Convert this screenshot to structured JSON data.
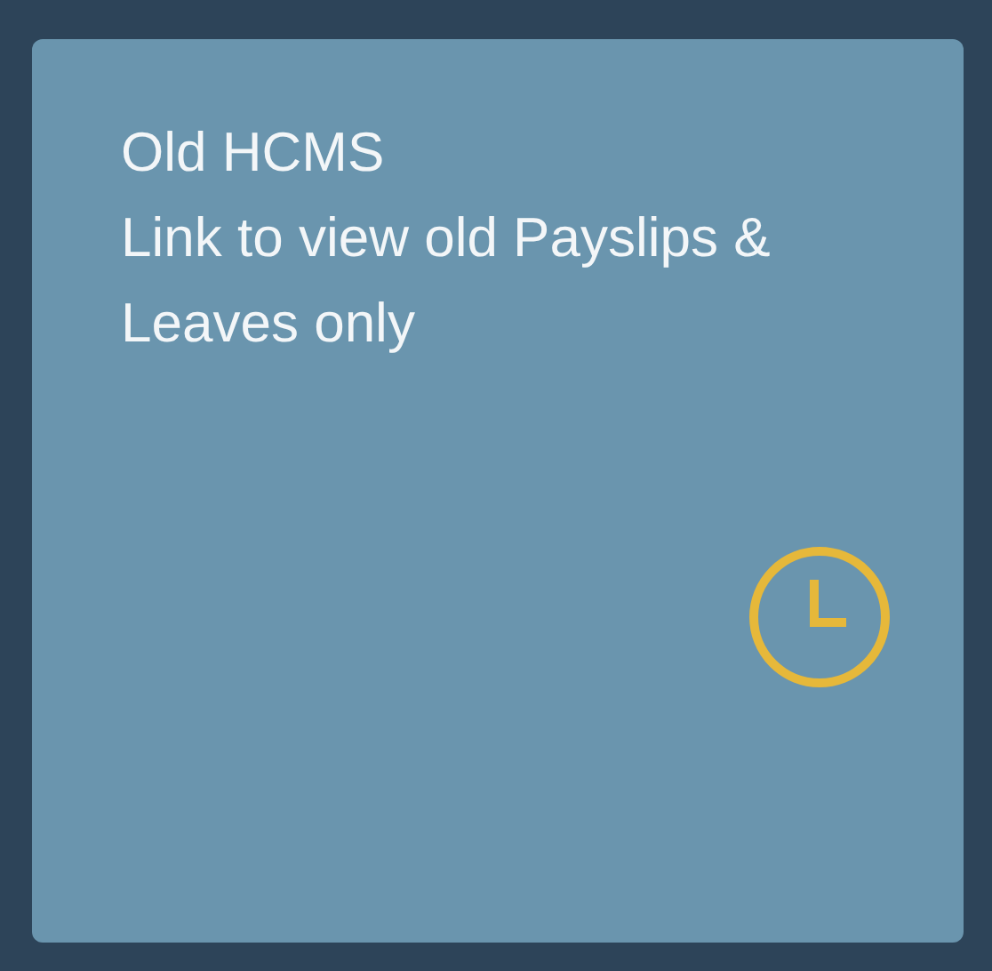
{
  "tile": {
    "title": "Old HCMS",
    "subtitle": "Link to view old Payslips & Leaves only"
  }
}
